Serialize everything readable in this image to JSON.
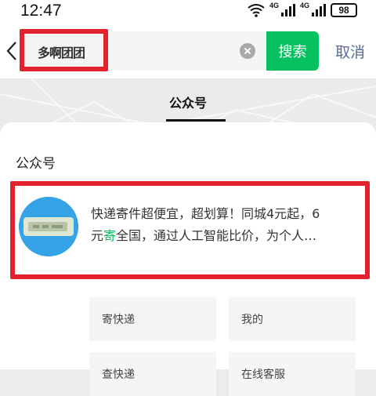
{
  "status_bar": {
    "time": "12:47",
    "net1": "4G",
    "net2": "4G",
    "battery": "98"
  },
  "search": {
    "value": "多啊团团",
    "button_label": "搜索",
    "cancel_label": "取消"
  },
  "tab": {
    "label": "公众号"
  },
  "section": {
    "title": "公众号"
  },
  "result": {
    "desc_line1": "快递寄件超便宜，超划算！同城4元起，6",
    "desc_line2_pre": "元",
    "desc_line2_hl": "寄",
    "desc_line2_post": "全国，通过人工智能比价，为个人…"
  },
  "menu": {
    "items": [
      "寄快递",
      "我的",
      "查快递",
      "在线客服"
    ]
  },
  "colors": {
    "accent": "#07c160",
    "link": "#576b95",
    "highlight_box": "#e4222d"
  }
}
